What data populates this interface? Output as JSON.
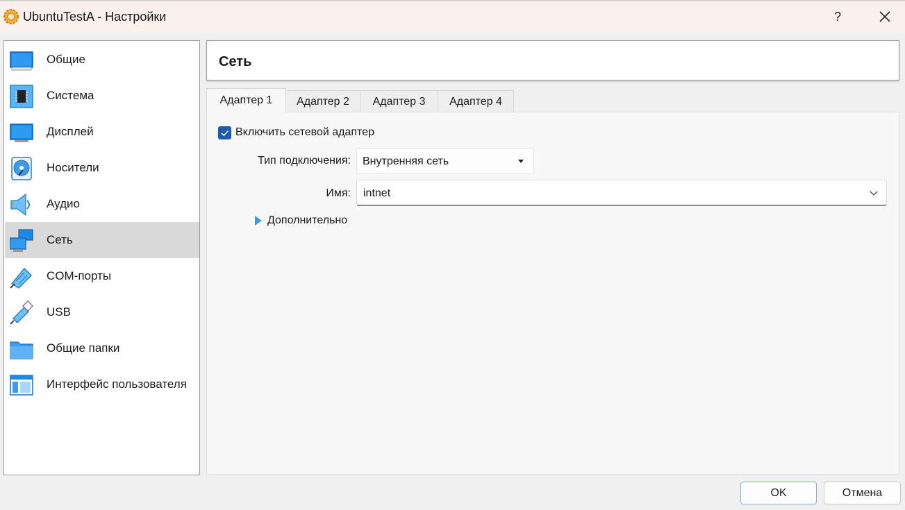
{
  "window": {
    "title": "UbuntuTestA - Настройки",
    "help": "?"
  },
  "sidebar": {
    "items": [
      {
        "label": "Общие",
        "icon": "general-icon"
      },
      {
        "label": "Система",
        "icon": "system-chip-icon"
      },
      {
        "label": "Дисплей",
        "icon": "display-monitor-icon"
      },
      {
        "label": "Носители",
        "icon": "storage-disk-icon"
      },
      {
        "label": "Аудио",
        "icon": "audio-speaker-icon"
      },
      {
        "label": "Сеть",
        "icon": "network-icon",
        "selected": true
      },
      {
        "label": "COM-порты",
        "icon": "serial-port-icon"
      },
      {
        "label": "USB",
        "icon": "usb-icon"
      },
      {
        "label": "Общие папки",
        "icon": "shared-folder-icon"
      },
      {
        "label": "Интерфейс пользователя",
        "icon": "user-interface-icon"
      }
    ]
  },
  "section": {
    "title": "Сеть"
  },
  "tabs": [
    {
      "label": "Адаптер 1",
      "active": true
    },
    {
      "label": "Адаптер 2"
    },
    {
      "label": "Адаптер 3"
    },
    {
      "label": "Адаптер 4"
    }
  ],
  "adapter": {
    "enable_label": "Включить сетевой адаптер",
    "enabled": true,
    "attachment_label": "Тип подключения:",
    "attachment_value": "Внутренняя сеть",
    "name_label": "Имя:",
    "name_value": "intnet",
    "advanced_label": "Дополнительно"
  },
  "buttons": {
    "ok": "OK",
    "cancel": "Отмена"
  },
  "colors": {
    "accent": "#1f5aa8",
    "icon_blue": "#3d9be8",
    "selected_bg": "#d9d9d9",
    "titlebar_bg": "#fbf1ec"
  }
}
